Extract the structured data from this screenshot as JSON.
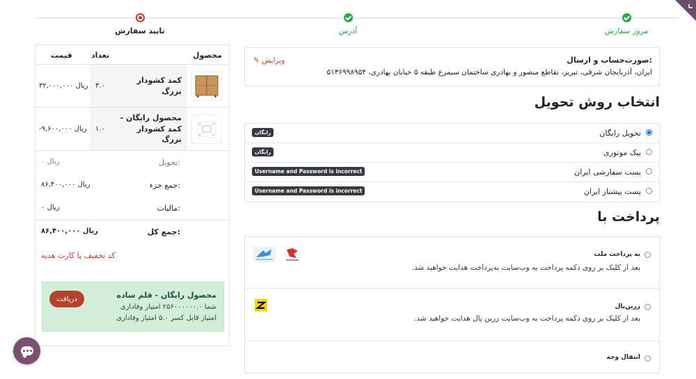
{
  "steps": [
    {
      "label": "مرور سفارش",
      "state": "done"
    },
    {
      "label": "آدرس",
      "state": "done"
    },
    {
      "label": "تایید سفارش",
      "state": "current"
    }
  ],
  "summary": {
    "headers": {
      "product": "محصول",
      "quantity": "تعداد",
      "price": "قیمت"
    },
    "items": [
      {
        "name": "کمد کشودار بزرگ",
        "qty": "۳.۰",
        "price": "۳۲,۰۰۰,۰۰۰ ریال"
      },
      {
        "name": "محصول رایگان - کمد کشودار بزرگ",
        "qty": "۱.۰",
        "price": "-۹,۶۰۰,۰۰۰ ریال"
      }
    ],
    "totals": {
      "delivery_label": "تحویل:",
      "delivery_value": "۰ ریال",
      "subtotal_label": "جمع جزء:",
      "subtotal_value": "۸۶,۴۰۰,۰۰۰ ریال",
      "tax_label": "مالیات:",
      "tax_value": "۰ ریال",
      "total_label": "جمع کل:",
      "total_value": "۸۶,۴۰۰,۰۰۰ ریال"
    },
    "promo_link": "کد تخفیف یا کارت هدیه",
    "reward": {
      "title": "محصول رایگان - قلم ساده",
      "line1": "شما ۲۵۶۰۰۰۰۰۰.۰ امتیاز وفاداری",
      "line2": "امتیاز قابل کسر ۵.۰ امتیاز وفاداری",
      "button": "دریافت"
    }
  },
  "address": {
    "title": "صورت‌حساب و ارسال:",
    "text": "ایران، آذربایجان شرقی، تبریز، تقاطع منصور و بهادری ساختمان سیمرغ طبقه ۵ خیابان بهادری، ۵۱۳۶۹۹۸۹۵۴",
    "edit": "ویرایش"
  },
  "delivery": {
    "heading": "انتخاب روش تحویل",
    "options": [
      {
        "name": "تحویل رایگان",
        "badge": "رایگان",
        "selected": true
      },
      {
        "name": "پیک موتوری",
        "badge": "رایگان",
        "selected": false
      },
      {
        "name": "پست سفارشی ایران",
        "badge": "Username and Password is incorrect",
        "selected": false
      },
      {
        "name": "پست پیشتاز ایران",
        "badge": "Username and Password is incorrect",
        "selected": false
      }
    ]
  },
  "payment": {
    "heading": "پرداخت با",
    "options": [
      {
        "name": "به پرداخت ملت",
        "desc": "بعد از کلیک بر روی دکمه پرداخت به وب‌سایت به‌پرداخت هدایت خواهید شد.",
        "icons": [
          "bank-logo-icon",
          "mellat-logo-icon"
        ]
      },
      {
        "name": "زرین‌پال",
        "desc": "بعد از کلیک بر روی دکمه پرداخت به وب‌سایت زرین پال هدایت خواهید شد.",
        "icons": [
          "zarinpal-logo-icon"
        ]
      },
      {
        "name": "انتقال وجه",
        "desc": "",
        "icons": []
      }
    ]
  },
  "colors": {
    "success": "#28a745",
    "accent": "#c0392b",
    "chat": "#7b4f6e",
    "badge": "#343a40",
    "corner": "#6b4f6a"
  }
}
